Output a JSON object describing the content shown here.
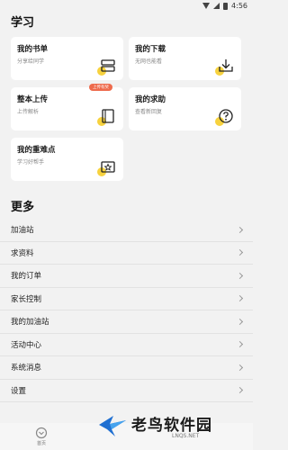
{
  "status_bar": {
    "time": "4:56"
  },
  "study": {
    "title": "学习",
    "cards": [
      {
        "title": "我的书单",
        "subtitle": "分享给同学",
        "icon": "booklist-icon"
      },
      {
        "title": "我的下载",
        "subtitle": "无网也能看",
        "icon": "download-icon"
      },
      {
        "title": "整本上传",
        "subtitle": "上传解析",
        "icon": "upload-book-icon",
        "badge": "上传有奖"
      },
      {
        "title": "我的求助",
        "subtitle": "查看新回复",
        "icon": "help-icon"
      },
      {
        "title": "我的重难点",
        "subtitle": "学习好帮手",
        "icon": "star-book-icon"
      }
    ]
  },
  "more": {
    "title": "更多",
    "items": [
      {
        "label": "加油站"
      },
      {
        "label": "求资料"
      },
      {
        "label": "我的订单"
      },
      {
        "label": "家长控制"
      },
      {
        "label": "我的加油站"
      },
      {
        "label": "活动中心"
      },
      {
        "label": "系统消息"
      },
      {
        "label": "设置"
      }
    ]
  },
  "bottom_nav": {
    "home_label": "首页"
  },
  "watermark": {
    "title": "老鸟软件园",
    "domain": "LNQS.NET"
  },
  "colors": {
    "accent_yellow": "#f7d23e",
    "badge": "#ee6b4d",
    "background": "#f2f2f2"
  }
}
